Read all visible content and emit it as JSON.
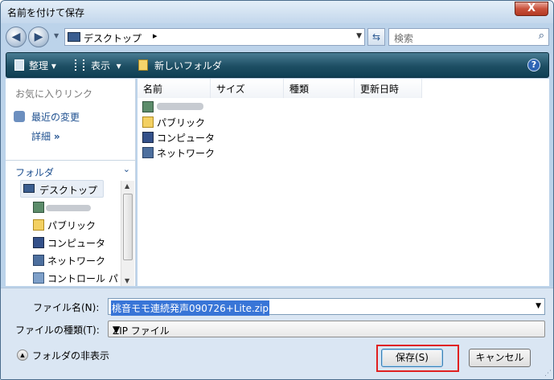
{
  "window": {
    "title": "名前を付けて保存",
    "close_label": "X"
  },
  "nav": {
    "back_icon": "back-arrow-icon",
    "forward_icon": "forward-arrow-icon",
    "location": "デスクトップ",
    "crumb_arrow": "▸",
    "search_placeholder": "検索"
  },
  "toolbar": {
    "organize": "整理",
    "views": "表示",
    "new_folder": "新しいフォルダ",
    "help": "?"
  },
  "left": {
    "favorites_title": "お気に入りリンク",
    "favorites": [
      {
        "label": "最近の変更"
      },
      {
        "label": "詳細",
        "suffix": "»"
      }
    ],
    "folders_title": "フォルダ",
    "tree": [
      "デスクトップ",
      "",
      "パブリック",
      "コンピュータ",
      "ネットワーク",
      "コントロール パ"
    ]
  },
  "columns": [
    "名前",
    "サイズ",
    "種類",
    "更新日時"
  ],
  "files": [
    "",
    "パブリック",
    "コンピュータ",
    "ネットワーク"
  ],
  "bottom": {
    "filename_label": "ファイル名(N):",
    "filename_value": "桃音モモ連続発声090726+Lite.zip",
    "filetype_label": "ファイルの種類(T):",
    "filetype_value": "ZIP ファイル",
    "hide_folders": "フォルダの非表示",
    "save": "保存(S)",
    "cancel": "キャンセル"
  },
  "colors": {
    "toolbar": "#1d4e63",
    "selection": "#3875d7",
    "highlight": "#e02020",
    "link": "#1d4f8f"
  }
}
